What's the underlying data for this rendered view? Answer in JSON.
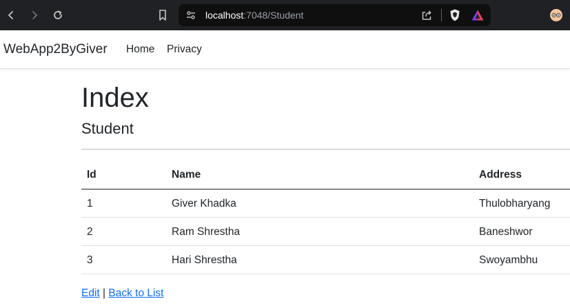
{
  "browser": {
    "url_host": "localhost",
    "url_rest": ":7048/Student",
    "icons": [
      "back-arrow-icon",
      "forward-arrow-icon",
      "reload-icon",
      "bookmark-icon",
      "site-info-icon",
      "share-icon",
      "brave-shields-icon",
      "brave-rewards-icon",
      "profile-avatar-icon"
    ]
  },
  "navbar": {
    "brand": "WebApp2ByGiver",
    "links": [
      "Home",
      "Privacy"
    ]
  },
  "page": {
    "title": "Index",
    "subtitle": "Student"
  },
  "table": {
    "columns": [
      "Id",
      "Name",
      "Address"
    ],
    "rows": [
      {
        "id": "1",
        "name": "Giver Khadka",
        "address": "Thulobharyang"
      },
      {
        "id": "2",
        "name": "Ram Shrestha",
        "address": "Baneshwor"
      },
      {
        "id": "3",
        "name": "Hari Shrestha",
        "address": "Swoyambhu"
      }
    ]
  },
  "footer_links": {
    "edit": "Edit",
    "separator": "|",
    "back": "Back to List"
  },
  "colors": {
    "chrome_bg": "#202124",
    "link": "#0d6efd",
    "text": "#212529"
  }
}
